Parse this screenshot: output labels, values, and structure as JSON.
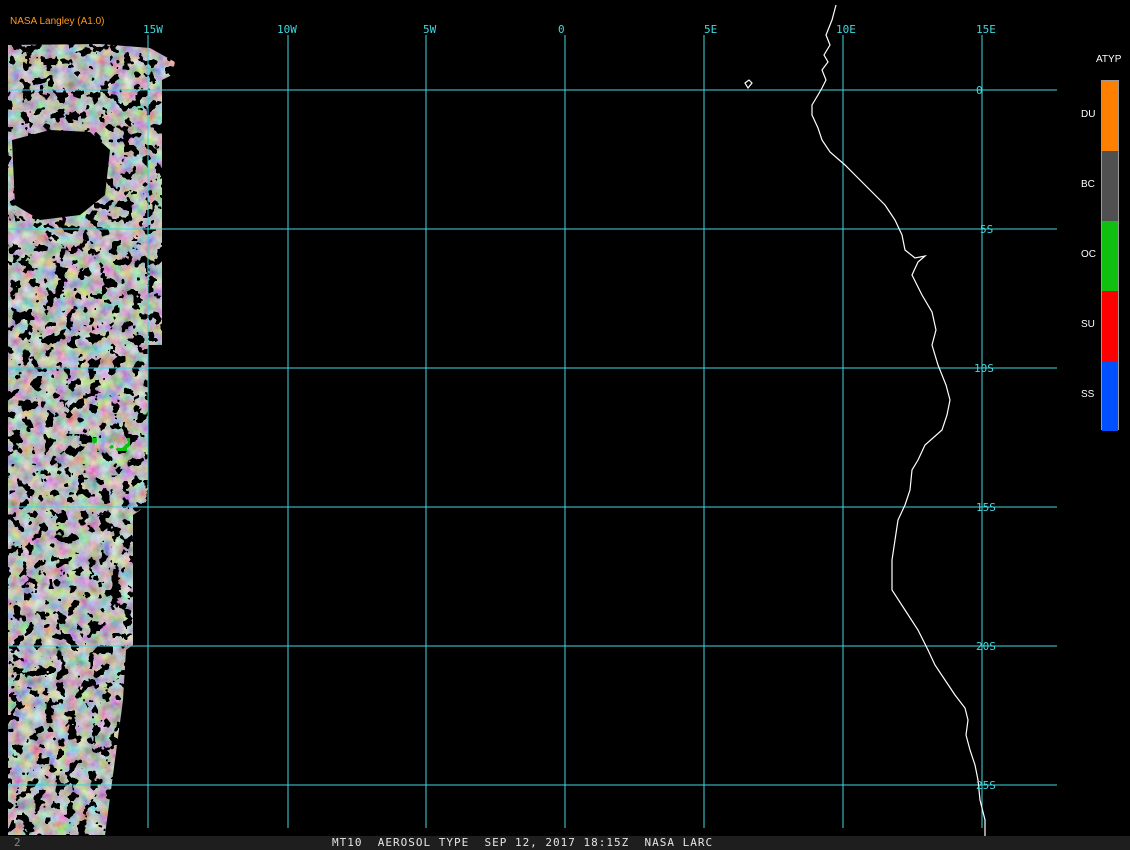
{
  "credit": "NASA Langley (A1.0)",
  "lon_labels": [
    "15W",
    "10W",
    "5W",
    "0",
    "5E",
    "10E",
    "15E"
  ],
  "lat_labels": [
    "0",
    "5S",
    "10S",
    "15S",
    "20S",
    "25S"
  ],
  "legend": {
    "title": "ATYP",
    "items": [
      {
        "code": "DU",
        "color": "#ff8000"
      },
      {
        "code": "BC",
        "color": "#505050"
      },
      {
        "code": "OC",
        "color": "#10c010"
      },
      {
        "code": "SU",
        "color": "#ff0000"
      },
      {
        "code": "SS",
        "color": "#0050ff"
      }
    ]
  },
  "colors": {
    "grid": "#3fd8e0",
    "coast": "#ffffff",
    "oc": "#10c010",
    "ss": "#0a14f0"
  },
  "bottom": {
    "left_number": "2",
    "title": "MT10  AEROSOL TYPE  SEP 12, 2017 18:15Z  NASA LARC"
  }
}
